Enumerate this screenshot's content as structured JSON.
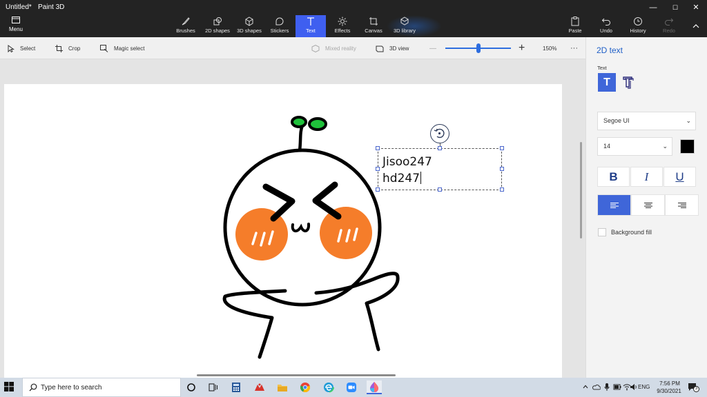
{
  "titlebar": {
    "title": "Untitled*",
    "app_name": "Paint 3D"
  },
  "window_controls": {
    "minimize": "—",
    "maximize": "☐",
    "close": "✕"
  },
  "menu": {
    "label": "Menu"
  },
  "ribbon": {
    "tools": [
      {
        "label": "Brushes",
        "icon": "brush-icon"
      },
      {
        "label": "2D shapes",
        "icon": "2d-shapes-icon"
      },
      {
        "label": "3D shapes",
        "icon": "3d-shapes-icon"
      },
      {
        "label": "Stickers",
        "icon": "stickers-icon"
      },
      {
        "label": "Text",
        "icon": "text-icon",
        "active": true
      },
      {
        "label": "Effects",
        "icon": "effects-icon"
      },
      {
        "label": "Canvas",
        "icon": "canvas-icon"
      },
      {
        "label": "3D library",
        "icon": "3d-library-icon"
      }
    ],
    "right_tools": [
      {
        "label": "Paste",
        "icon": "paste-icon"
      },
      {
        "label": "Undo",
        "icon": "undo-icon"
      },
      {
        "label": "History",
        "icon": "history-icon"
      },
      {
        "label": "Redo",
        "icon": "redo-icon",
        "disabled": true
      }
    ]
  },
  "toolbar2": {
    "select": "Select",
    "crop": "Crop",
    "magic_select": "Magic select",
    "mixed_reality": "Mixed reality",
    "view_3d": "3D view",
    "zoom_minus": "—",
    "zoom_plus": "+",
    "zoom_level": "150%",
    "zoom_fraction": 0.5,
    "more": "···"
  },
  "canvas": {
    "text_lines": [
      "Jisoo247",
      "hd247"
    ]
  },
  "panel": {
    "title": "2D text",
    "text_label": "Text",
    "text_2d_glyph": "T",
    "text_3d_glyph": "T",
    "font": "Segoe UI",
    "size": "14",
    "color": "#000000",
    "bold": "B",
    "italic": "I",
    "underline": "U",
    "alignment": "left",
    "background_fill": "Background fill"
  },
  "taskbar": {
    "search_placeholder": "Type here to search",
    "apps": [
      "cortana-icon",
      "task-view-icon",
      "calculator-icon",
      "photos-icon",
      "file-explorer-icon",
      "chrome-icon",
      "edge-icon",
      "zoom-icon",
      "paint-3d-icon"
    ],
    "language": "ENG",
    "time": "7:56 PM",
    "date": "9/30/2021",
    "notification_count": "3",
    "accent": "#3f66d9"
  }
}
